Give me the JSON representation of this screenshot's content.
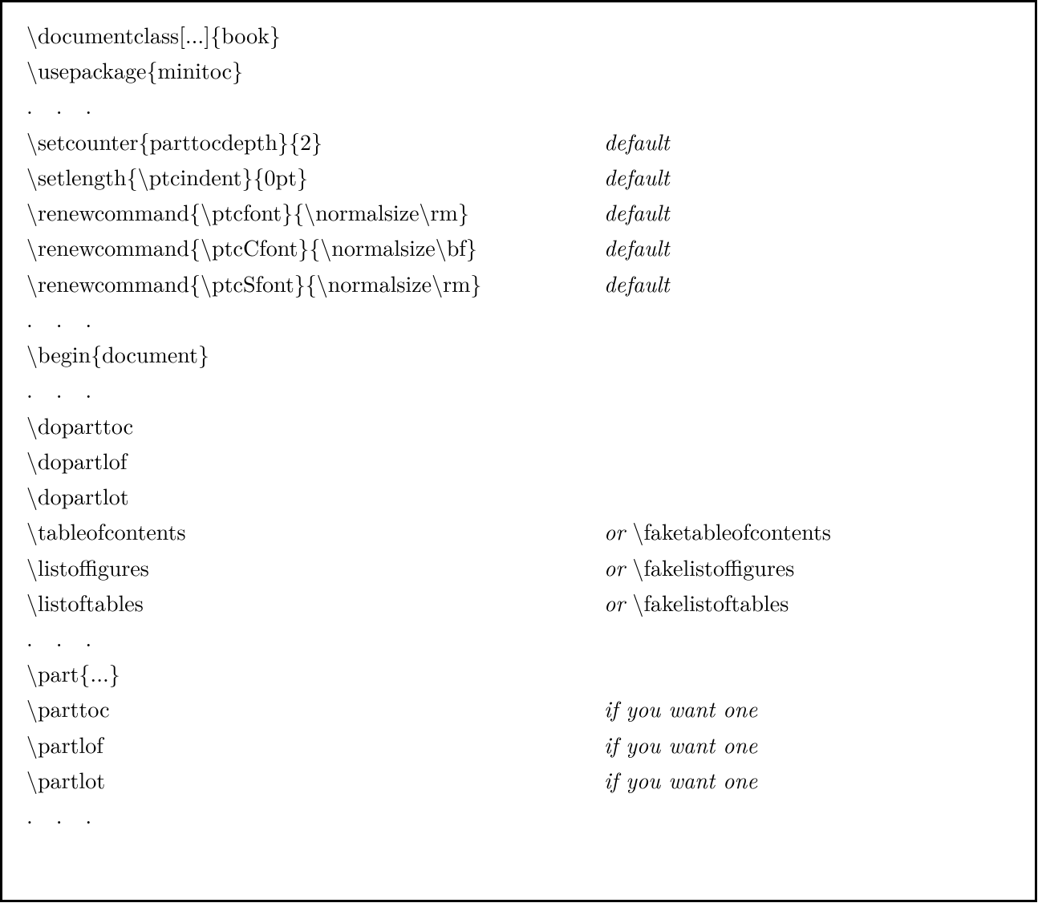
{
  "rows": [
    {
      "left": "\\documentclass[...]{book}",
      "right": ""
    },
    {
      "left": "\\usepackage{minitoc}",
      "right": ""
    },
    {
      "left": ". . .",
      "right": "",
      "dots": true
    },
    {
      "left": "\\setcounter{parttocdepth}{2}",
      "right": "default",
      "rightItalic": true
    },
    {
      "left": "\\setlength{\\ptcindent}{0pt}",
      "right": "default",
      "rightItalic": true
    },
    {
      "left": "\\renewcommand{\\ptcfont}{\\normalsize\\rm}",
      "right": "default",
      "rightItalic": true
    },
    {
      "left": "\\renewcommand{\\ptcCfont}{\\normalsize\\bf}",
      "right": "default",
      "rightItalic": true
    },
    {
      "left": "\\renewcommand{\\ptcSfont}{\\normalsize\\rm}",
      "right": "default",
      "rightItalic": true
    },
    {
      "left": ". . .",
      "right": "",
      "dots": true
    },
    {
      "left": "\\begin{document}",
      "right": ""
    },
    {
      "left": ". . .",
      "right": "",
      "dots": true
    },
    {
      "left": "\\doparttoc",
      "right": ""
    },
    {
      "left": "\\dopartlof",
      "right": ""
    },
    {
      "left": "\\dopartlot",
      "right": ""
    },
    {
      "left": "\\tableofcontents",
      "rightItalicWord": "or",
      "rightRoman": "\\faketableofcontents"
    },
    {
      "left": "\\listoffigures",
      "rightItalicWord": "or",
      "rightRoman": "\\fakelistoffigures"
    },
    {
      "left": "\\listoftables",
      "rightItalicWord": "or",
      "rightRoman": "\\fakelistoftables"
    },
    {
      "left": ". . .",
      "right": "",
      "dots": true
    },
    {
      "left": "\\part{...}",
      "right": ""
    },
    {
      "left": "\\parttoc",
      "right": "if you want one",
      "rightItalic": true
    },
    {
      "left": "\\partlof",
      "right": "if you want one",
      "rightItalic": true
    },
    {
      "left": "\\partlot",
      "right": "if you want one",
      "rightItalic": true
    },
    {
      "left": ". . .",
      "right": "",
      "dots": true
    }
  ]
}
